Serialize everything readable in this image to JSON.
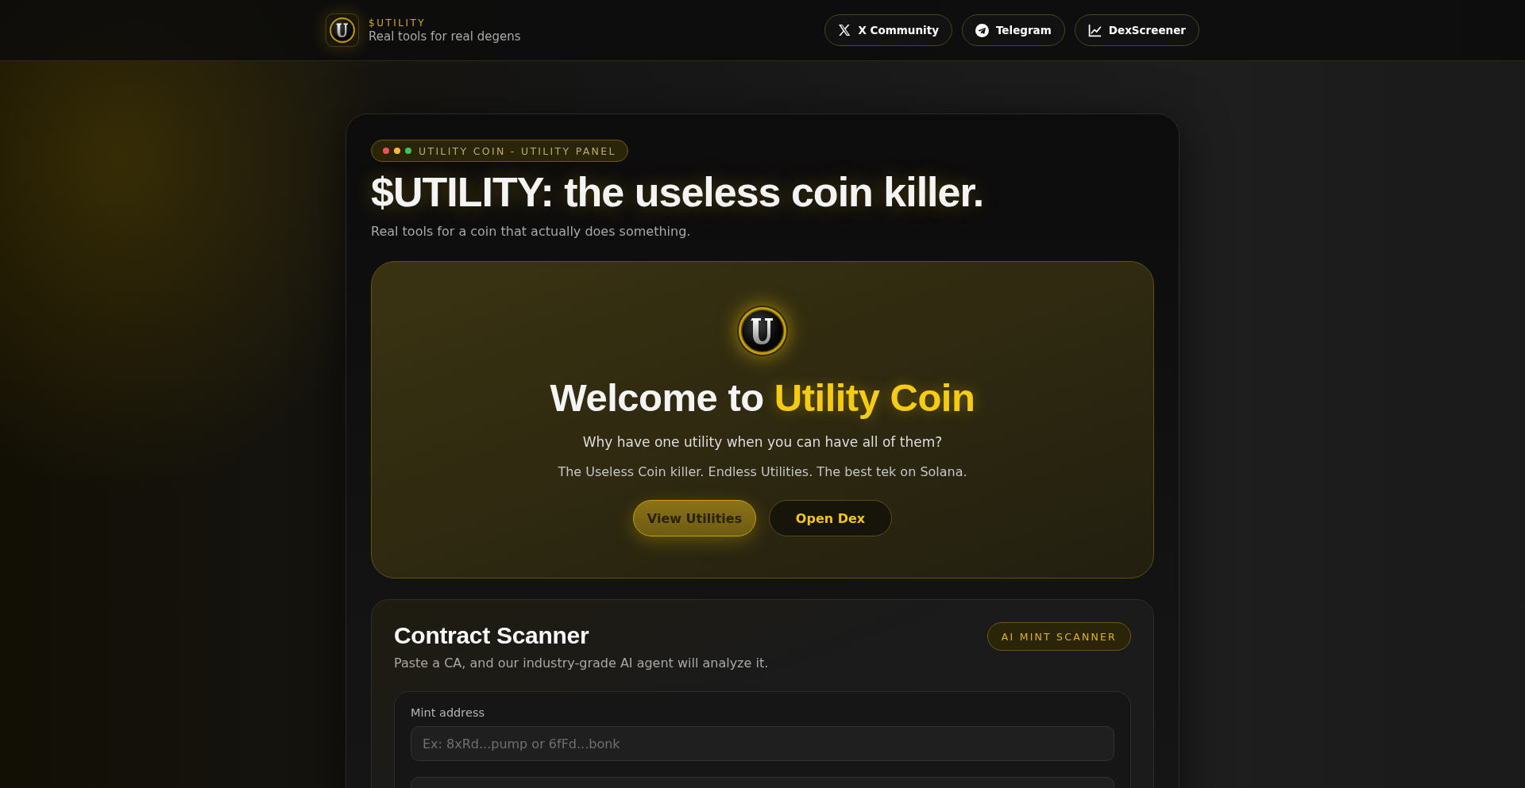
{
  "header": {
    "brand": "$UTILITY",
    "tagline": "Real tools for real degens",
    "links": [
      {
        "kind": "x",
        "label": "X Community"
      },
      {
        "kind": "telegram",
        "label": "Telegram"
      },
      {
        "kind": "chart",
        "label": "DexScreener"
      }
    ]
  },
  "panel": {
    "badge": {
      "dots": [
        {
          "color": "#ef5350"
        },
        {
          "color": "#f5b942"
        },
        {
          "color": "#3fc25a"
        }
      ],
      "label": "UTILITY COIN - UTILITY PANEL"
    },
    "title": "$UTILITY: the useless coin killer.",
    "subtitle": "Real tools for a coin that actually does something.",
    "hero": {
      "title": "Welcome to",
      "title_highlight": "Utility Coin",
      "lead": "Why have one utility when you can have all of them?",
      "text": "The Useless Coin killer. Endless Utilities. The best tek on Solana.",
      "buttons": [
        {
          "kind": "primary",
          "label": "View Utilities"
        },
        {
          "kind": "secondary",
          "label": "Open Dex"
        }
      ]
    },
    "scanner": {
      "title": "Contract Scanner",
      "badge": "AI MINT SCANNER",
      "description": "Paste a CA, and our industry-grade AI agent will analyze it.",
      "field_label": "Mint address",
      "placeholder": "Ex: 8xRd...pump or 6fFd...bonk"
    }
  }
}
